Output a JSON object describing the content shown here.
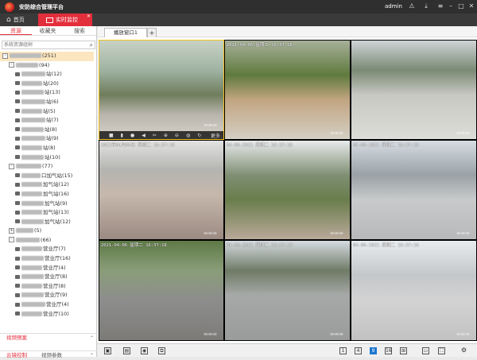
{
  "app": {
    "title": "安防综合管理平台",
    "user": "admin"
  },
  "top_tabs": [
    {
      "label": "首页"
    },
    {
      "label": "实时监控"
    }
  ],
  "sidebar": {
    "tabs": [
      "资源",
      "收藏夹",
      "搜索"
    ],
    "search_placeholder": "系统资源组树",
    "tree": [
      {
        "label": "(251)",
        "level": 0,
        "toggle": "-",
        "sel": true
      },
      {
        "label": "(94)",
        "level": 1,
        "toggle": "-"
      },
      {
        "label": "站(12)",
        "level": 2
      },
      {
        "label": "站(20)",
        "level": 2
      },
      {
        "label": "站(13)",
        "level": 2
      },
      {
        "label": "站(6)",
        "level": 2
      },
      {
        "label": "站(5)",
        "level": 2
      },
      {
        "label": "站(7)",
        "level": 2
      },
      {
        "label": "站(8)",
        "level": 2
      },
      {
        "label": "站(9)",
        "level": 2
      },
      {
        "label": "站(8)",
        "level": 2
      },
      {
        "label": "站(10)",
        "level": 2
      },
      {
        "label": "(77)",
        "level": 1,
        "toggle": "-"
      },
      {
        "label": "口加气站(15)",
        "level": 2
      },
      {
        "label": "加气站(12)",
        "level": 2
      },
      {
        "label": "加气站(16)",
        "level": 2
      },
      {
        "label": "加气站(9)",
        "level": 2
      },
      {
        "label": "加气站(13)",
        "level": 2
      },
      {
        "label": "加气站(12)",
        "level": 2
      },
      {
        "label": "(5)",
        "level": 1,
        "toggle": "+"
      },
      {
        "label": "(66)",
        "level": 1,
        "toggle": "-"
      },
      {
        "label": "营业厅(7)",
        "level": 2
      },
      {
        "label": "营业厅(16)",
        "level": 2
      },
      {
        "label": "营业厅(4)",
        "level": 2
      },
      {
        "label": "营业厅(8)",
        "level": 2
      },
      {
        "label": "营业厅(8)",
        "level": 2
      },
      {
        "label": "营业厅(9)",
        "level": 2
      },
      {
        "label": "营业厅(4)",
        "level": 2
      },
      {
        "label": "营业厅(10)",
        "level": 2
      }
    ],
    "bottom_panels": [
      "视频预案",
      "云镜控制",
      "视频参数"
    ]
  },
  "main": {
    "window_tab": "播放窗口1",
    "add_tab": "+"
  },
  "cells": [
    {
      "ts": "",
      "style": "a",
      "toolbar": true,
      "more": "更多"
    },
    {
      "ts": "2021-04-06 星期二 16:37:18",
      "style": "b"
    },
    {
      "ts": "",
      "style": "c"
    },
    {
      "ts": "2021年04月06日 星期二 16:37:18",
      "style": "d"
    },
    {
      "ts": "04-06-2021 星期二 16:37:18",
      "style": "e"
    },
    {
      "ts": "04-06-2021 星期二 16:37:18",
      "style": "f"
    },
    {
      "ts": "2021-04-06 星期二 16:37:18",
      "style": "g"
    },
    {
      "ts": "04-06-2021 星期二 16:37:18",
      "style": "h"
    },
    {
      "ts": "04-06-2021 星期二 16:37:18",
      "style": "i"
    }
  ]
}
